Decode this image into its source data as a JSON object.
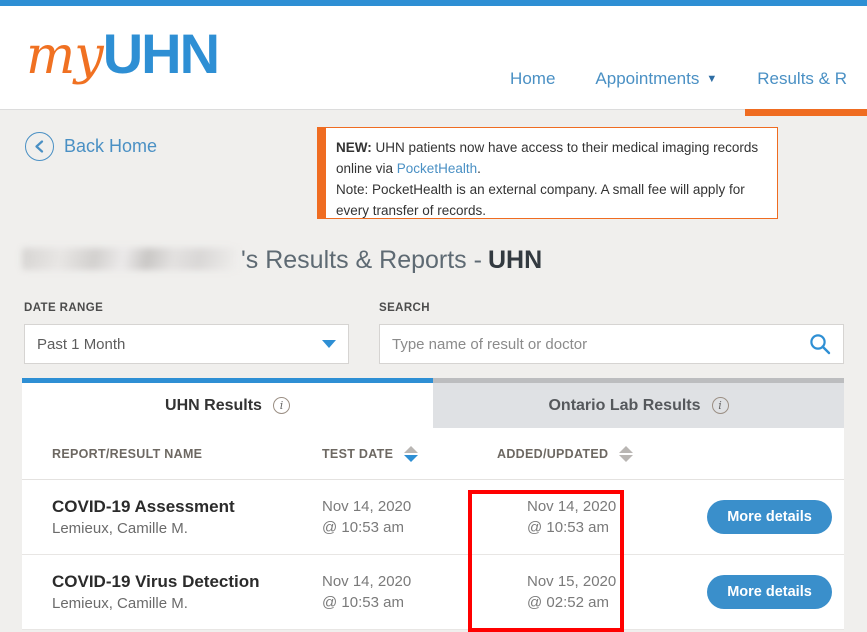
{
  "brand": {
    "logo_my": "my",
    "logo_uhn": "UHN",
    "accent_blue": "#2e8fd4",
    "accent_orange": "#ef6c21"
  },
  "nav": {
    "items": [
      {
        "label": "Home",
        "caret": "",
        "active": false
      },
      {
        "label": "Appointments",
        "caret": "▼",
        "active": false
      },
      {
        "label": "Results & R",
        "caret": "",
        "active": true
      }
    ]
  },
  "back": {
    "label": "Back Home",
    "icon": "chevron-left-circle-icon"
  },
  "notice": {
    "badge": "NEW:",
    "line1_rest": " UHN patients now have access to their medical imaging records online via ",
    "link": "PocketHealth",
    "line1_end": ".",
    "line2": "Note: PocketHealth is an external company. A small fee will apply for every transfer of records.",
    "border_color": "#ef6c21"
  },
  "title": {
    "redacted_name": "",
    "possessive": "'s Results & Reports -",
    "org": "UHN"
  },
  "filters": {
    "date_range_label": "DATE RANGE",
    "date_range_value": "Past 1 Month",
    "search_label": "SEARCH",
    "search_value": "",
    "search_placeholder": "Type name of result or doctor"
  },
  "tabs": [
    {
      "label": "UHN Results",
      "info": "i",
      "active": true
    },
    {
      "label": "Ontario Lab Results",
      "info": "i",
      "active": false
    }
  ],
  "table": {
    "headers": {
      "name": "REPORT/RESULT NAME",
      "test_date": "TEST DATE",
      "added_updated": "ADDED/UPDATED"
    },
    "rows": [
      {
        "name": "COVID-19 Assessment",
        "doctor": "Lemieux, Camille M.",
        "test_date_day": "Nov 14, 2020",
        "test_date_time": "@ 10:53 am",
        "added_day": "Nov 14, 2020",
        "added_time": "@ 10:53 am",
        "action": "More details"
      },
      {
        "name": "COVID-19 Virus Detection",
        "doctor": "Lemieux, Camille M.",
        "test_date_day": "Nov 14, 2020",
        "test_date_time": "@ 10:53 am",
        "added_day": "Nov 15, 2020",
        "added_time": "@ 02:52 am",
        "action": "More details"
      }
    ]
  },
  "annotation": {
    "color": "#ff0000"
  }
}
